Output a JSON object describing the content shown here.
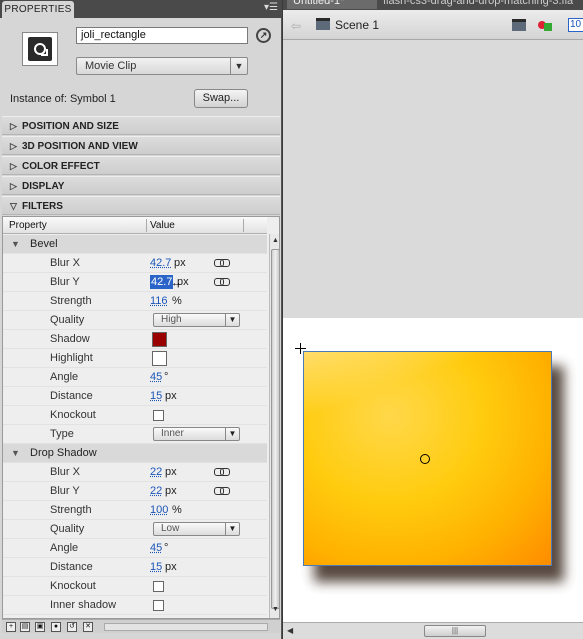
{
  "panel": {
    "tab_label": "PROPERTIES",
    "instance_name": "joli_rectangle",
    "symbol_type": "Movie Clip",
    "instance_of_label": "Instance of:",
    "instance_of_value": "Symbol 1",
    "swap_label": "Swap..."
  },
  "sections": [
    {
      "label": "POSITION AND SIZE",
      "expanded": false
    },
    {
      "label": "3D POSITION AND VIEW",
      "expanded": false
    },
    {
      "label": "COLOR EFFECT",
      "expanded": false
    },
    {
      "label": "DISPLAY",
      "expanded": false
    },
    {
      "label": "FILTERS",
      "expanded": true
    }
  ],
  "filters": {
    "col_property": "Property",
    "col_value": "Value",
    "bevel": {
      "name": "Bevel",
      "blur_x": {
        "label": "Blur X",
        "value": "42.7",
        "unit": "px"
      },
      "blur_y": {
        "label": "Blur Y",
        "value": "42.7",
        "unit": "px"
      },
      "strength": {
        "label": "Strength",
        "value": "116",
        "unit": "%"
      },
      "quality": {
        "label": "Quality",
        "value": "High"
      },
      "shadow": {
        "label": "Shadow",
        "color": "#990000"
      },
      "highlight": {
        "label": "Highlight",
        "color": "#ffffff"
      },
      "angle": {
        "label": "Angle",
        "value": "45",
        "unit": "°"
      },
      "distance": {
        "label": "Distance",
        "value": "15",
        "unit": "px"
      },
      "knockout": {
        "label": "Knockout",
        "checked": false
      },
      "type": {
        "label": "Type",
        "value": "Inner"
      }
    },
    "drop_shadow": {
      "name": "Drop Shadow",
      "blur_x": {
        "label": "Blur X",
        "value": "22",
        "unit": "px"
      },
      "blur_y": {
        "label": "Blur Y",
        "value": "22",
        "unit": "px"
      },
      "strength": {
        "label": "Strength",
        "value": "100",
        "unit": "%"
      },
      "quality": {
        "label": "Quality",
        "value": "Low"
      },
      "angle": {
        "label": "Angle",
        "value": "45",
        "unit": "°"
      },
      "distance": {
        "label": "Distance",
        "value": "15",
        "unit": "px"
      },
      "knockout": {
        "label": "Knockout",
        "checked": false
      },
      "inner_shadow": {
        "label": "Inner shadow",
        "checked": false
      }
    }
  },
  "stage": {
    "doc_tab_active": "Untitled-1*",
    "doc_tab_other": "flash-cs3-drag-and-drop-matching-3.fla",
    "scene_label": "Scene 1",
    "zoom": "10",
    "rect_color": "#ffc400"
  },
  "icons": {
    "panel_menu": "panel-menu-icon",
    "symbol": "movie-clip-symbol-icon",
    "edit_symbol": "edit-symbol-icon",
    "link": "link-icon",
    "scene": "clapperboard-icon",
    "edit_scene": "edit-scene-icon",
    "edit_symbols": "edit-symbols-icon"
  }
}
